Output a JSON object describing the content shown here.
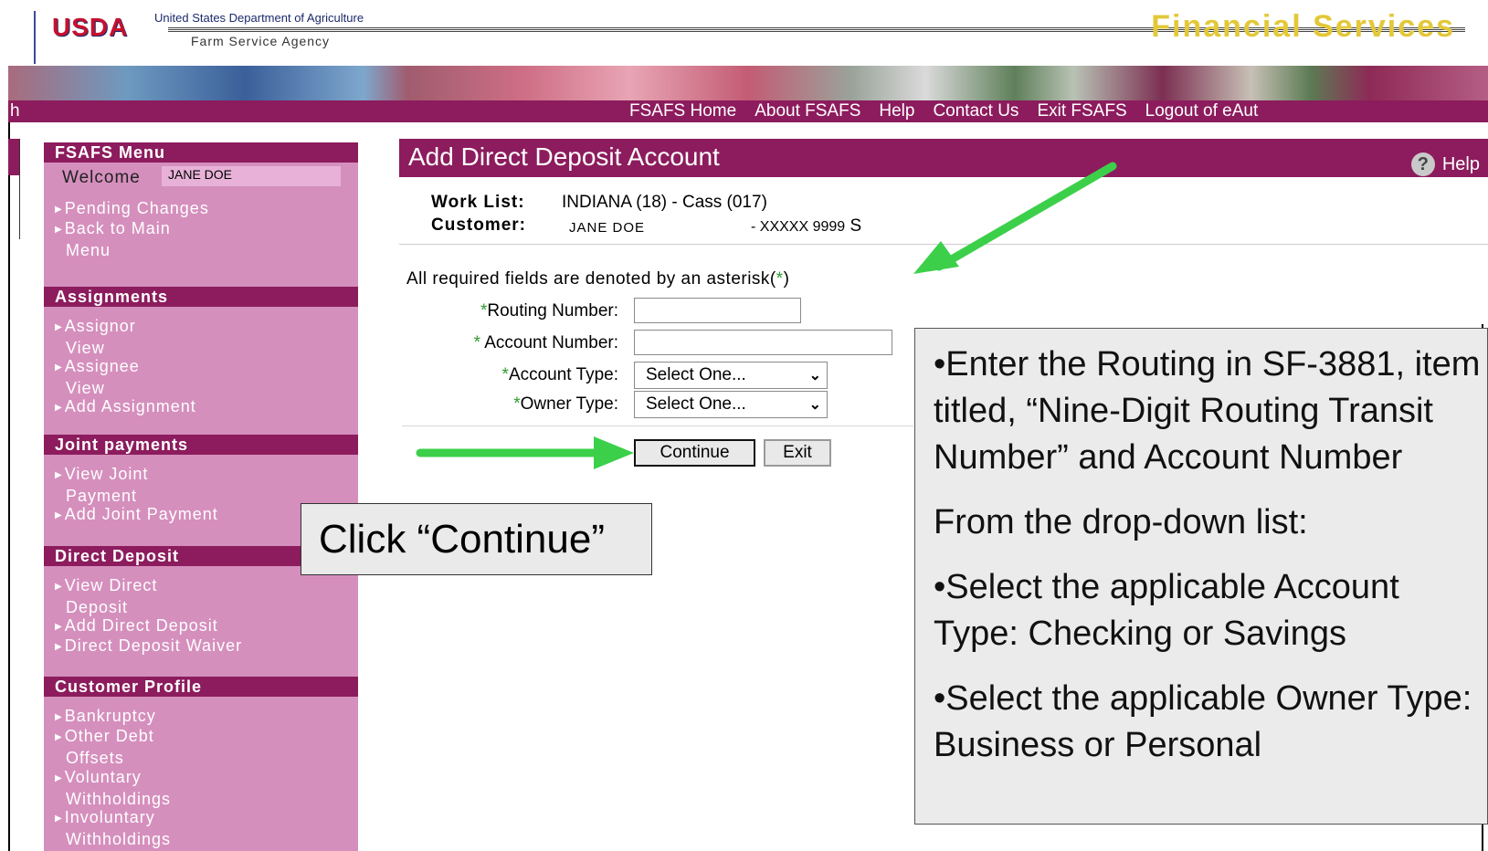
{
  "colors": {
    "brand": "#8c1c5d",
    "sidebar": "#d58fbd",
    "arrow": "#3cd04a",
    "asterisk": "#2e9b2e"
  },
  "header": {
    "logo": "USDA",
    "department": "United States Department of Agriculture",
    "agency": "Farm Service Agency",
    "title": "Financial Services"
  },
  "nav": {
    "leading_fragment": "h",
    "links": [
      "FSAFS Home",
      "About FSAFS",
      "Help",
      "Contact Us",
      "Exit FSAFS",
      "Logout of eAut"
    ]
  },
  "sidebar": {
    "menu_title": "FSAFS Menu",
    "welcome_label": "Welcome",
    "welcome_name": "JANE DOE",
    "menu_items": [
      {
        "label": "Pending Changes",
        "cont": ""
      },
      {
        "label": "Back to Main",
        "cont": "Menu"
      }
    ],
    "assignments": {
      "title": "Assignments",
      "items": [
        {
          "label": "Assignor",
          "cont": "View"
        },
        {
          "label": "Assignee",
          "cont": "View"
        },
        {
          "label": "Add Assignment",
          "cont": ""
        }
      ]
    },
    "joint": {
      "title": "Joint payments",
      "items": [
        {
          "label": "View Joint",
          "cont": "Payment"
        },
        {
          "label": "Add Joint Payment",
          "cont": ""
        }
      ]
    },
    "direct": {
      "title": "Direct Deposit",
      "items": [
        {
          "label": "View Direct",
          "cont": "Deposit"
        },
        {
          "label": "Add Direct Deposit",
          "cont": ""
        },
        {
          "label": "Direct Deposit Waiver",
          "cont": ""
        }
      ]
    },
    "profile": {
      "title": "Customer Profile",
      "items": [
        {
          "label": "Bankruptcy",
          "cont": ""
        },
        {
          "label": "Other Debt",
          "cont": "Offsets"
        },
        {
          "label": "Voluntary",
          "cont": "Withholdings"
        },
        {
          "label": "Involuntary",
          "cont": "Withholdings"
        }
      ]
    }
  },
  "main": {
    "title": "Add Direct Deposit Account",
    "help_label": "Help",
    "worklist_label": "Work List:",
    "worklist_value": "INDIANA (18) - Cass (017)",
    "customer_label": "Customer:",
    "customer_name": "JANE DOE",
    "customer_id": "- XXXXX 9999",
    "customer_suffix": "S",
    "required_note_prefix": "All required fields are denoted by an asterisk(",
    "required_note_suffix": ")",
    "asterisk": "*",
    "fields": {
      "routing_label": "Routing Number:",
      "account_label": "Account Number:",
      "account_type_label": "Account Type:",
      "owner_type_label": "Owner Type:",
      "routing_value": "",
      "account_value": "",
      "account_type_selected": "Select One...",
      "owner_type_selected": "Select One..."
    },
    "continue_label": "Continue",
    "exit_label": "Exit"
  },
  "callouts": {
    "left": "Click “Continue”",
    "right": [
      "•Enter the Routing in SF-3881, item titled, “Nine-Digit Routing Transit Number” and Account Number",
      "From the drop-down list:",
      "•Select the applicable Account Type: Checking or Savings",
      "•Select the applicable Owner Type: Business or Personal"
    ]
  }
}
